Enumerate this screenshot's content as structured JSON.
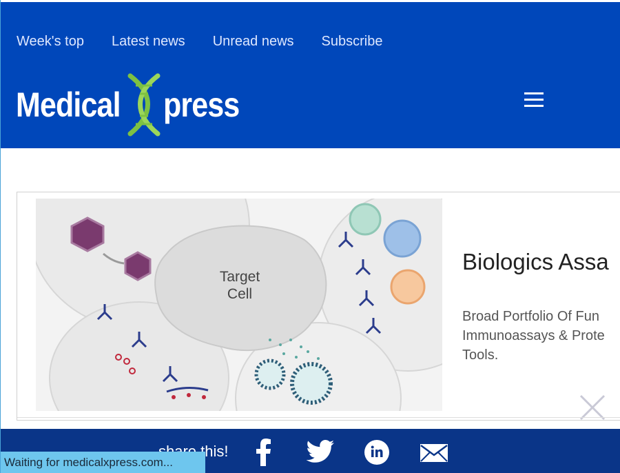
{
  "header": {
    "nav": [
      {
        "label": "Week's top"
      },
      {
        "label": "Latest news"
      },
      {
        "label": "Unread news"
      },
      {
        "label": "Subscribe"
      }
    ],
    "logo": {
      "part1": "Medical",
      "part2": "press"
    },
    "menu_icon": "hamburger-icon"
  },
  "ad": {
    "image_label_line1": "Target",
    "image_label_line2": "Cell",
    "title": "Biologics Assa",
    "description": "Broad Portfolio Of Fun Immunoassays & Prote Tools.",
    "close_icon": "close-icon"
  },
  "sharebar": {
    "label": "share this!",
    "icons": [
      "facebook-icon",
      "twitter-icon",
      "linkedin-icon",
      "email-icon"
    ]
  },
  "status_bar": {
    "text": "Waiting for medicalxpress.com..."
  },
  "colors": {
    "header_bg": "#0047ba",
    "logo_green": "#7dc142",
    "sharebar_bg": "#0a3588",
    "status_bg": "#6ec6ee"
  }
}
